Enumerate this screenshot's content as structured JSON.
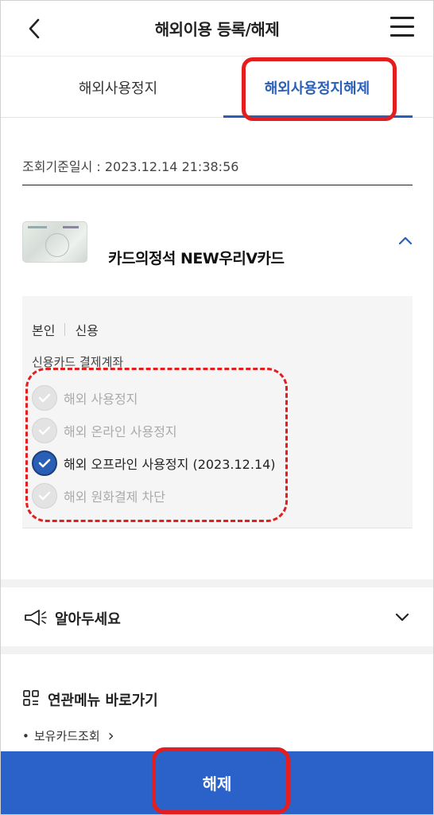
{
  "header": {
    "title": "해외이용 등록/해제",
    "back_icon": "chevron-left-icon",
    "menu_icon": "hamburger-menu-icon"
  },
  "tabs": [
    {
      "label": "해외사용정지",
      "active": false
    },
    {
      "label": "해외사용정지해제",
      "active": true
    }
  ],
  "query": {
    "text": "조회기준일시 : 2023.12.14 21:38:56"
  },
  "card": {
    "name": "카드의정석 NEW우리V카드",
    "owner": "본인",
    "type": "신용",
    "account_label": "신용카드 결제계좌"
  },
  "options": [
    {
      "label": "해외 사용정지",
      "checked": false
    },
    {
      "label": "해외 온라인 사용정지",
      "checked": false
    },
    {
      "label": "해외 오프라인 사용정지 (2023.12.14)",
      "checked": true
    },
    {
      "label": "해외 원화결제 차단",
      "checked": false
    }
  ],
  "notice": {
    "label": "알아두세요",
    "icon": "megaphone-icon"
  },
  "related": {
    "title": "연관메뉴 바로가기",
    "icon": "grid-menu-icon",
    "links": [
      {
        "bullet": "•",
        "label": "보유카드조회",
        "arrow": "›"
      }
    ]
  },
  "bottom_button": {
    "label": "해제"
  },
  "colors": {
    "accent": "#2a5fb8",
    "button": "#2a62c9",
    "highlight": "#e41e1e"
  }
}
